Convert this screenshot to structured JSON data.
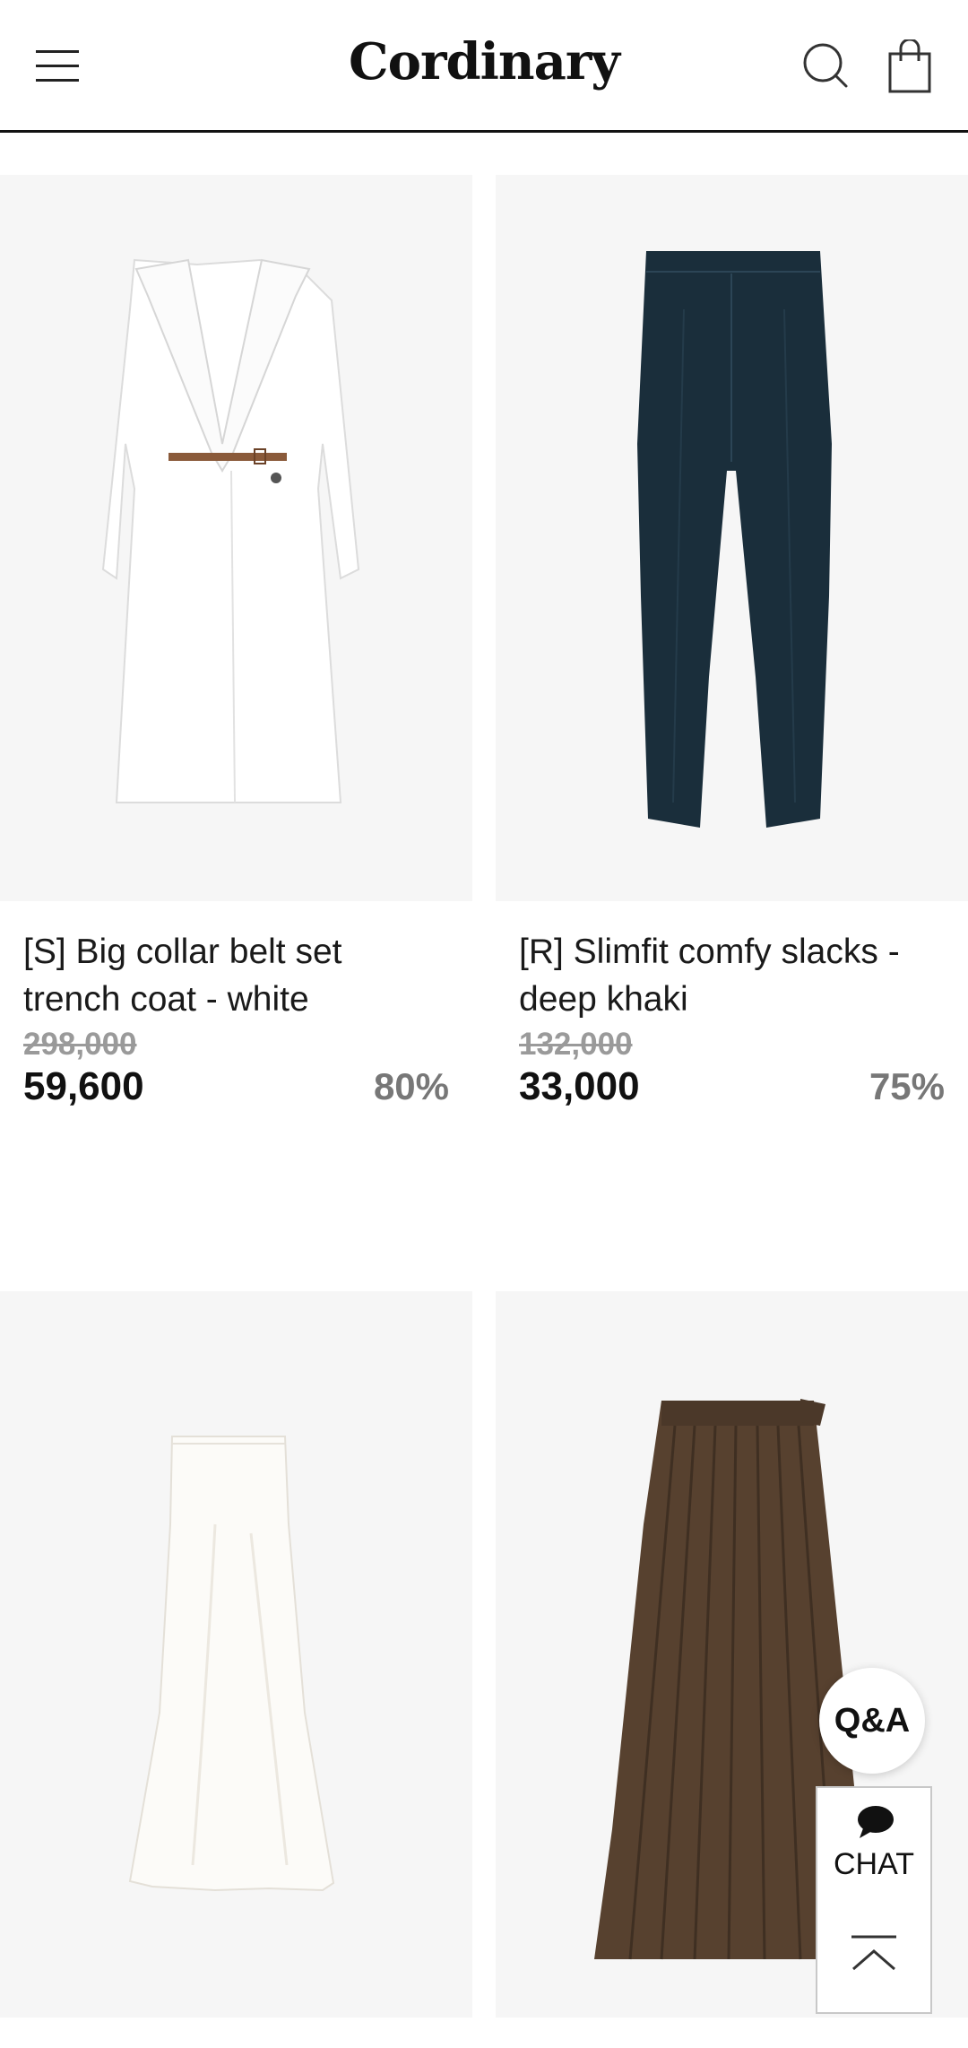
{
  "header": {
    "logo": "Cordinary",
    "menu_icon": "hamburger-menu-icon",
    "search_icon": "search-icon",
    "cart_icon": "shopping-bag-icon"
  },
  "products": [
    {
      "name_line1": "[S] Big collar belt set",
      "name_line2": "trench coat - white",
      "original_price": "298,000",
      "sale_price": "59,600",
      "discount": "80%",
      "image": "white-trench-coat"
    },
    {
      "name_line1": "[R] Slimfit comfy slacks -",
      "name_line2": "deep khaki",
      "original_price": "132,000",
      "sale_price": "33,000",
      "discount": "75%",
      "image": "navy-slacks"
    },
    {
      "image": "white-satin-skirt"
    },
    {
      "image": "brown-pleated-skirt"
    }
  ],
  "floating": {
    "qa_label": "Q&A",
    "chat_label": "CHAT",
    "chat_icon": "speech-bubble-icon",
    "top_icon": "scroll-to-top-icon"
  },
  "colors": {
    "photo_bg": "#f6f6f6",
    "strike_price": "#9a9a9a",
    "discount": "#777777",
    "header_border": "#111111"
  }
}
